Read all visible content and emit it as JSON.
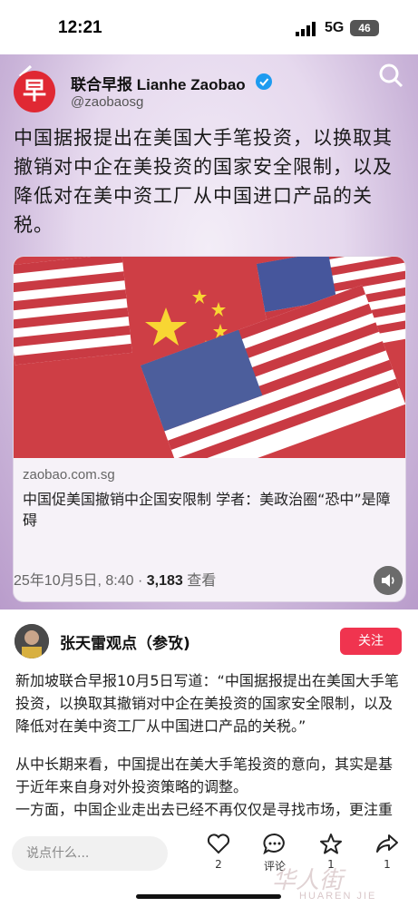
{
  "status_bar": {
    "time": "12:21",
    "network": "5G",
    "battery": "46"
  },
  "tweet": {
    "account_name": "联合早报 Lianhe Zaobao",
    "account_handle": "@zaobaosg",
    "logo_char": "早",
    "text": "中国据报提出在美国大手笔投资，以换取其撤销对中企在美投资的国家安全限制，以及降低对在美中资工厂从中国进口产品的关税。",
    "link_domain": "zaobao.com.sg",
    "link_title": "中国促美国撤销中企国安限制 学者：美政治圈“恐中”是障碍",
    "date": "25年10月5日, 8:40 · ",
    "views_count": "3,183",
    "views_label": " 查看"
  },
  "author": {
    "name": "张天雷观点（参攷)",
    "follow_label": "关注"
  },
  "post": {
    "paragraphs": [
      "新加坡联合早报10月5日写道：“中国据报提出在美国大手笔投资，以换取其撤销对中企在美投资的国家安全限制，以及降低对在美中资工厂从中国进口产品的关税。”",
      "从中长期来看，中国提出在美大手笔投资的意向，其实是基于近年来自身对外投资策略的调整。",
      "一方面，中国企业走出去已经不再仅仅是寻找市场，更注重"
    ]
  },
  "bottom_bar": {
    "comment_placeholder": "说点什么...",
    "like_count": "2",
    "comment_label": "评论",
    "favorite_count": "1",
    "share_count": "1"
  },
  "watermark": {
    "text": "华人街",
    "sub": "HUAREN JIE"
  },
  "colors": {
    "follow_button": "#f0344f",
    "logo_red": "#e02833",
    "verified_blue": "#1d9bf0"
  }
}
